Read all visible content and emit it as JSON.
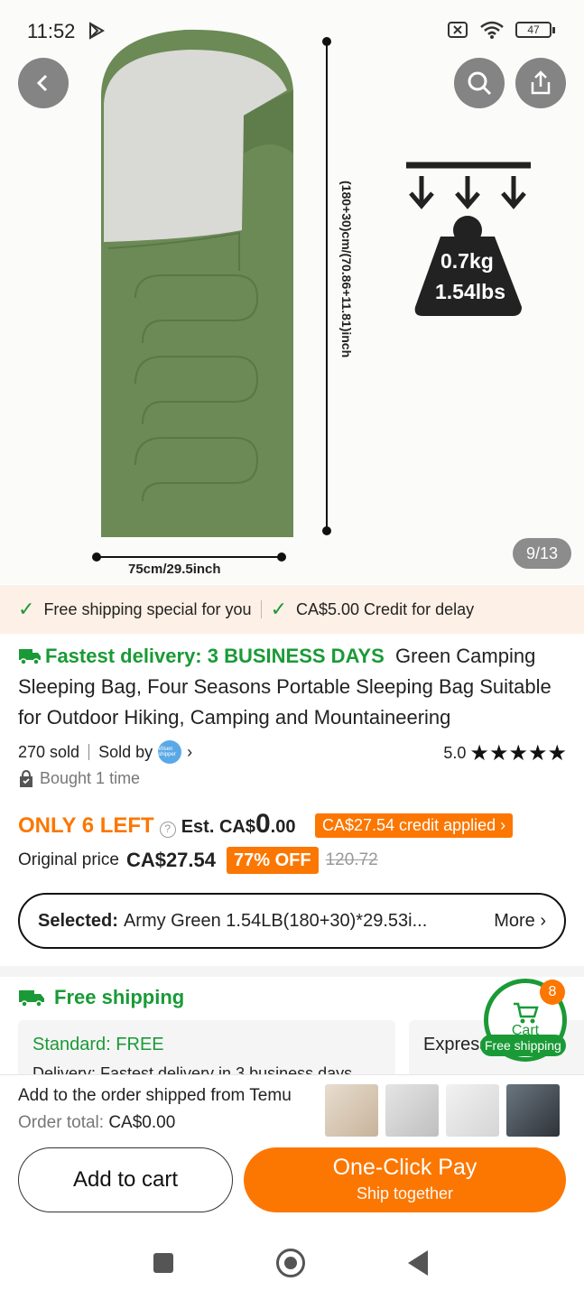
{
  "status_bar": {
    "time": "11:52",
    "battery": "47"
  },
  "gallery": {
    "counter": "9/13",
    "dim_length": "(180+30)cm/(70.86+11.81)inch",
    "dim_width": "75cm/29.5inch",
    "weight_kg": "0.7kg",
    "weight_lbs": "1.54lbs"
  },
  "promo": {
    "left": "Free shipping special for you",
    "right": "CA$5.00 Credit for delay"
  },
  "product": {
    "fastest": "Fastest delivery: 3 BUSINESS DAYS",
    "title": "Green Camping Sleeping Bag, Four Seasons Portable Sleeping Bag Suitable for Outdoor Hiking, Camping and Mountaineering",
    "sold": "270 sold",
    "sold_by": "Sold by",
    "seller_logo_text": "Vilsen shipper",
    "rating": "5.0",
    "stars": 5,
    "bought": "Bought 1 time"
  },
  "pricing": {
    "only_left": "ONLY 6 LEFT",
    "est_prefix": "Est. CA$",
    "est_int": "0",
    "est_dec": ".00",
    "credit": "CA$27.54 credit applied",
    "orig_label": "Original price",
    "orig_amount": "CA$27.54",
    "off": "77% OFF",
    "strike": "120.72"
  },
  "selection": {
    "label": "Selected:",
    "value": "Army Green 1.54LB(180+30)*29.53i...",
    "more": "More"
  },
  "shipping": {
    "head": "Free shipping",
    "standard": "Standard: FREE",
    "delivery": "Delivery: Fastest delivery in 3 business days",
    "express": "Express"
  },
  "cart": {
    "label": "Cart",
    "count": "8",
    "free": "Free shipping"
  },
  "bottom": {
    "order_text": "Add to the order shipped from Temu",
    "total_label": "Order total:",
    "total_value": "CA$0.00",
    "add_to_cart": "Add to cart",
    "pay_l1": "One-Click Pay",
    "pay_l2": "Ship together"
  },
  "colors": {
    "accent": "#fb7701",
    "green": "#1a9a36",
    "bag": "#6b8a55"
  }
}
